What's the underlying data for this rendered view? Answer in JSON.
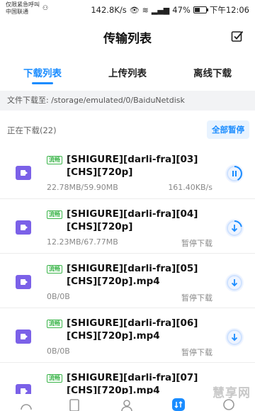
{
  "status_bar": {
    "carrier_line1": "仅限紧急呼叫",
    "carrier_line2": "中国联通",
    "speed": "142.8K/s",
    "battery": "47%",
    "time": "下午12:06"
  },
  "header": {
    "title": "传输列表"
  },
  "tabs": [
    {
      "label": "下载列表",
      "active": true
    },
    {
      "label": "上传列表",
      "active": false
    },
    {
      "label": "离线下载",
      "active": false
    }
  ],
  "path_bar": {
    "text": "文件下载至: /storage/emulated/0/BaiduNetdisk"
  },
  "section": {
    "title": "正在下载(22)",
    "pause_all_label": "全部暂停"
  },
  "items": [
    {
      "badge": "流畅",
      "name": "[SHIGURE][darli-fra][03][CHS][720p]",
      "size": "22.78MB/59.90MB",
      "status": "161.40KB/s",
      "action": "pause"
    },
    {
      "badge": "流畅",
      "name": "[SHIGURE][darli-fra][04][CHS][720p]",
      "size": "12.23MB/67.77MB",
      "status": "暂停下载",
      "action": "download"
    },
    {
      "badge": "流畅",
      "name": "[SHIGURE][darli-fra][05][CHS][720p].mp4",
      "size": "0B/0B",
      "status": "暂停下载",
      "action": "download"
    },
    {
      "badge": "流畅",
      "name": "[SHIGURE][darli-fra][06][CHS][720p].mp4",
      "size": "0B/0B",
      "status": "暂停下载",
      "action": "download"
    },
    {
      "badge": "流畅",
      "name": "[SHIGURE][darli-fra][07][CHS][720p].mp4",
      "size": "",
      "status": "",
      "action": "download"
    }
  ],
  "watermark": "慧享网",
  "colors": {
    "accent": "#1a8cff",
    "file_icon": "#7b61e8",
    "badge": "#3bb54a"
  }
}
